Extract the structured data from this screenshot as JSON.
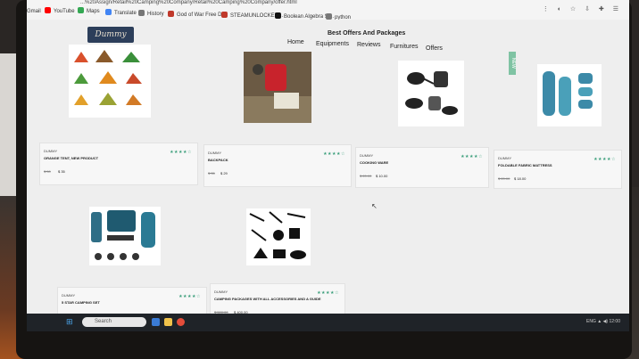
{
  "browser": {
    "url": "...%20Assign/Retail%20Camping%20Company/Retail%20Camping%20Company/offer.html",
    "bookmarks": [
      {
        "label": "Gmail",
        "color": "#d93025"
      },
      {
        "label": "YouTube",
        "color": "#ff0000"
      },
      {
        "label": "Maps",
        "color": "#34a853"
      },
      {
        "label": "Translate",
        "color": "#4285f4"
      },
      {
        "label": "History",
        "color": "#777777"
      },
      {
        "label": "God of War Free D...",
        "color": "#c0392b"
      },
      {
        "label": "STEAMUNLOCKED...",
        "color": "#c0392b"
      },
      {
        "label": "Boolean Algebra Si...",
        "color": "#111111"
      },
      {
        "label": "python",
        "color": "#777777"
      }
    ]
  },
  "site": {
    "logo": "Dummy",
    "promo_title": "Best Offers And Packages",
    "side_tab": "NEW",
    "nav": [
      "Home",
      "Equipments",
      "Reviews",
      "Furnitures",
      "Offers"
    ]
  },
  "products": [
    {
      "brand": "DUMMY",
      "name": "ORANGE TENT, NEW PRODUCT",
      "old_price": "$ 50",
      "new_price": "$ 35",
      "stars": "★★★★☆",
      "image": "tents-icon"
    },
    {
      "brand": "DUMMY",
      "name": "BACKPACK",
      "old_price": "$ 35",
      "new_price": "$ 29",
      "stars": "★★★★☆",
      "image": "backpack-icon"
    },
    {
      "brand": "DUMMY",
      "name": "COOKING WARE",
      "old_price": "$ 20.00",
      "new_price": "$ 10.00",
      "stars": "★★★★☆",
      "image": "cookware-icon"
    },
    {
      "brand": "DUMMY",
      "name": "FOLDABLE FABRIC MATTRESS",
      "old_price": "$ 20.00",
      "new_price": "$ 18.00",
      "stars": "★★★★☆",
      "image": "mattress-icon"
    },
    {
      "brand": "DUMMY",
      "name": "5 STAR CAMPING SET",
      "old_price": "$ 70.00",
      "new_price": "$ 45.00",
      "stars": "★★★★☆",
      "image": "camping-set-icon"
    },
    {
      "brand": "DUMMY",
      "name": "CAMPING PACKAGES WITH ALL ACCESSORIES AND A GUIDE",
      "old_price": "$ 500.00",
      "new_price": "$ 400.00",
      "stars": "★★★★☆",
      "image": "accessories-icon"
    }
  ],
  "taskbar": {
    "search_placeholder": "Search",
    "tray": "ENG  ▲  ◀)  12:00"
  }
}
